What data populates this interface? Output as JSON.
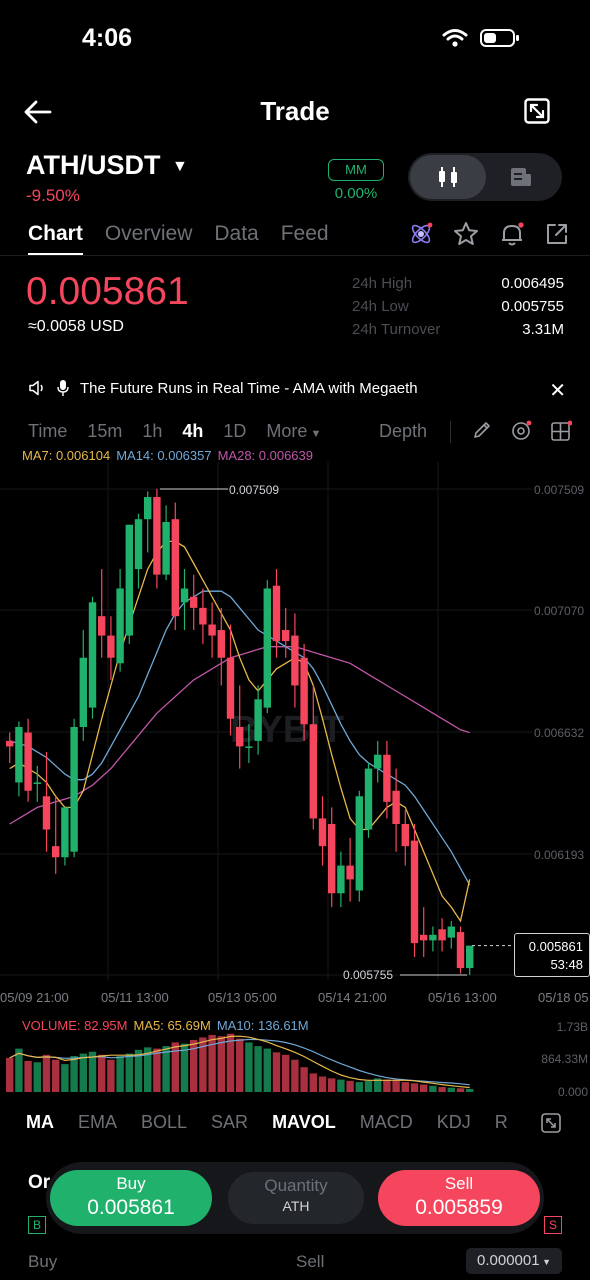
{
  "status": {
    "time": "4:06"
  },
  "header": {
    "title": "Trade"
  },
  "pair": {
    "name": "ATH/USDT",
    "change": "-9.50%",
    "mm_label": "MM",
    "mm_value": "0.00%"
  },
  "tabs": [
    {
      "label": "Chart",
      "active": true
    },
    {
      "label": "Overview",
      "active": false
    },
    {
      "label": "Data",
      "active": false
    },
    {
      "label": "Feed",
      "active": false
    }
  ],
  "price": {
    "last": "0.005861",
    "usd": "≈0.0058 USD",
    "stats": [
      {
        "label": "24h High",
        "value": "0.006495"
      },
      {
        "label": "24h Low",
        "value": "0.005755"
      },
      {
        "label": "24h Turnover",
        "value": "3.31M"
      }
    ]
  },
  "banner": {
    "text": "The Future Runs in Real Time -  AMA with Megaeth"
  },
  "intervals": [
    {
      "label": "Time",
      "active": false
    },
    {
      "label": "15m",
      "active": false
    },
    {
      "label": "1h",
      "active": false
    },
    {
      "label": "4h",
      "active": true
    },
    {
      "label": "1D",
      "active": false
    },
    {
      "label": "More",
      "active": false
    }
  ],
  "depth_label": "Depth",
  "ma_readout": {
    "ma7": "MA7: 0.006104",
    "ma14": "MA14: 0.006357",
    "ma28": "MA28: 0.006639"
  },
  "colors": {
    "up": "#20b26c",
    "down": "#f6465d",
    "ma7": "#e8b84a",
    "ma14": "#6fa8d6",
    "ma28": "#c056a8"
  },
  "chart": {
    "y_labels": [
      "0.007509",
      "0.007070",
      "0.006632",
      "0.006193",
      "0.005755"
    ],
    "x_labels": [
      "05/09 21:00",
      "05/11 13:00",
      "05/13 05:00",
      "05/14 21:00",
      "05/16 13:00",
      "05/18 05"
    ],
    "high_marker": "0.007509",
    "low_marker": "0.005755",
    "price_tag": "0.005861",
    "countdown": "53:48",
    "watermark": "BYBIT"
  },
  "chart_data": {
    "type": "candlestick",
    "ylim": [
      0.005755,
      0.007509
    ],
    "candles": [
      {
        "o": 0.0066,
        "h": 0.00663,
        "c": 0.00658,
        "l": 0.00652
      },
      {
        "o": 0.00645,
        "h": 0.00667,
        "c": 0.00665,
        "l": 0.0064
      },
      {
        "o": 0.00663,
        "h": 0.00668,
        "c": 0.00642,
        "l": 0.00638
      },
      {
        "o": 0.00645,
        "h": 0.00651,
        "c": 0.00645,
        "l": 0.00638
      },
      {
        "o": 0.0064,
        "h": 0.00656,
        "c": 0.00628,
        "l": 0.0062
      },
      {
        "o": 0.00622,
        "h": 0.0064,
        "c": 0.00618,
        "l": 0.00612
      },
      {
        "o": 0.00618,
        "h": 0.00636,
        "c": 0.00636,
        "l": 0.00615
      },
      {
        "o": 0.0062,
        "h": 0.00668,
        "c": 0.00665,
        "l": 0.00618
      },
      {
        "o": 0.00665,
        "h": 0.007,
        "c": 0.0069,
        "l": 0.0066
      },
      {
        "o": 0.00672,
        "h": 0.00712,
        "c": 0.0071,
        "l": 0.00668
      },
      {
        "o": 0.00705,
        "h": 0.00722,
        "c": 0.00698,
        "l": 0.0069
      },
      {
        "o": 0.00698,
        "h": 0.00705,
        "c": 0.0069,
        "l": 0.00682
      },
      {
        "o": 0.00688,
        "h": 0.00722,
        "c": 0.00715,
        "l": 0.00685
      },
      {
        "o": 0.00698,
        "h": 0.00738,
        "c": 0.00738,
        "l": 0.00695
      },
      {
        "o": 0.00722,
        "h": 0.00742,
        "c": 0.0074,
        "l": 0.00715
      },
      {
        "o": 0.0074,
        "h": 0.0075,
        "c": 0.00748,
        "l": 0.00728
      },
      {
        "o": 0.00748,
        "h": 0.00751,
        "c": 0.0072,
        "l": 0.00715
      },
      {
        "o": 0.0072,
        "h": 0.00745,
        "c": 0.00739,
        "l": 0.00718
      },
      {
        "o": 0.0074,
        "h": 0.00746,
        "c": 0.00705,
        "l": 0.007
      },
      {
        "o": 0.0071,
        "h": 0.00722,
        "c": 0.00715,
        "l": 0.007
      },
      {
        "o": 0.00712,
        "h": 0.0072,
        "c": 0.00708,
        "l": 0.007
      },
      {
        "o": 0.00708,
        "h": 0.00715,
        "c": 0.00702,
        "l": 0.00695
      },
      {
        "o": 0.00702,
        "h": 0.0071,
        "c": 0.00698,
        "l": 0.0069
      },
      {
        "o": 0.007,
        "h": 0.00708,
        "c": 0.0069,
        "l": 0.0068
      },
      {
        "o": 0.0069,
        "h": 0.00702,
        "c": 0.00668,
        "l": 0.00662
      },
      {
        "o": 0.00665,
        "h": 0.0068,
        "c": 0.00658,
        "l": 0.0065
      },
      {
        "o": 0.00658,
        "h": 0.00666,
        "c": 0.00658,
        "l": 0.00652
      },
      {
        "o": 0.0066,
        "h": 0.0068,
        "c": 0.00675,
        "l": 0.00655
      },
      {
        "o": 0.00672,
        "h": 0.00718,
        "c": 0.00715,
        "l": 0.0067
      },
      {
        "o": 0.00716,
        "h": 0.00722,
        "c": 0.00696,
        "l": 0.0069
      },
      {
        "o": 0.007,
        "h": 0.00708,
        "c": 0.00696,
        "l": 0.0069
      },
      {
        "o": 0.00698,
        "h": 0.00706,
        "c": 0.0068,
        "l": 0.00672
      },
      {
        "o": 0.0069,
        "h": 0.00695,
        "c": 0.00666,
        "l": 0.0066
      },
      {
        "o": 0.00666,
        "h": 0.0068,
        "c": 0.00632,
        "l": 0.00628
      },
      {
        "o": 0.00632,
        "h": 0.0064,
        "c": 0.00622,
        "l": 0.00615
      },
      {
        "o": 0.0063,
        "h": 0.00636,
        "c": 0.00605,
        "l": 0.006
      },
      {
        "o": 0.00605,
        "h": 0.0062,
        "c": 0.00615,
        "l": 0.006
      },
      {
        "o": 0.00615,
        "h": 0.00625,
        "c": 0.0061,
        "l": 0.00602
      },
      {
        "o": 0.00606,
        "h": 0.00642,
        "c": 0.0064,
        "l": 0.00602
      },
      {
        "o": 0.00628,
        "h": 0.00652,
        "c": 0.0065,
        "l": 0.00625
      },
      {
        "o": 0.0065,
        "h": 0.0066,
        "c": 0.00655,
        "l": 0.00645
      },
      {
        "o": 0.00655,
        "h": 0.0066,
        "c": 0.00638,
        "l": 0.00632
      },
      {
        "o": 0.00642,
        "h": 0.0065,
        "c": 0.0063,
        "l": 0.0062
      },
      {
        "o": 0.0063,
        "h": 0.00635,
        "c": 0.00622,
        "l": 0.00615
      },
      {
        "o": 0.00624,
        "h": 0.0063,
        "c": 0.00587,
        "l": 0.00582
      },
      {
        "o": 0.0059,
        "h": 0.006,
        "c": 0.00588,
        "l": 0.00582
      },
      {
        "o": 0.00588,
        "h": 0.00593,
        "c": 0.0059,
        "l": 0.00584
      },
      {
        "o": 0.00592,
        "h": 0.00596,
        "c": 0.00588,
        "l": 0.00584
      },
      {
        "o": 0.00589,
        "h": 0.00595,
        "c": 0.00593,
        "l": 0.00585
      },
      {
        "o": 0.00591,
        "h": 0.00593,
        "c": 0.00578,
        "l": 0.00576
      },
      {
        "o": 0.00578,
        "h": 0.00582,
        "c": 0.005861,
        "l": 0.005755
      }
    ],
    "ma7": [
      0.0065,
      0.00652,
      0.0065,
      0.00648,
      0.00645,
      0.0064,
      0.00636,
      0.00636,
      0.00642,
      0.00655,
      0.00668,
      0.0068,
      0.00692,
      0.00702,
      0.00712,
      0.00722,
      0.00728,
      0.00732,
      0.00732,
      0.0073,
      0.00724,
      0.00718,
      0.00712,
      0.00706,
      0.007,
      0.0069,
      0.00682,
      0.00678,
      0.00682,
      0.00686,
      0.00688,
      0.0069,
      0.00688,
      0.0068,
      0.00668,
      0.00655,
      0.00643,
      0.00632,
      0.00628,
      0.00628,
      0.00632,
      0.00636,
      0.00638,
      0.00636,
      0.00628,
      0.0062,
      0.00612,
      0.00604,
      0.006,
      0.00595,
      0.0061
    ],
    "ma14": [
      0.0066,
      0.00659,
      0.00658,
      0.00656,
      0.00654,
      0.00651,
      0.00648,
      0.00646,
      0.00646,
      0.00648,
      0.00652,
      0.00658,
      0.00664,
      0.0067,
      0.00676,
      0.00684,
      0.00692,
      0.007,
      0.00706,
      0.0071,
      0.00712,
      0.00714,
      0.00714,
      0.00714,
      0.00712,
      0.00708,
      0.00704,
      0.007,
      0.00698,
      0.00696,
      0.00694,
      0.00692,
      0.0069,
      0.00686,
      0.0068,
      0.00673,
      0.00666,
      0.0066,
      0.00655,
      0.00652,
      0.0065,
      0.00648,
      0.00646,
      0.00644,
      0.0064,
      0.00635,
      0.0063,
      0.00625,
      0.0062,
      0.00614,
      0.00608
    ],
    "ma28": [
      0.0063,
      0.00632,
      0.00634,
      0.00636,
      0.00637,
      0.00638,
      0.00639,
      0.0064,
      0.00642,
      0.00644,
      0.00647,
      0.0065,
      0.00654,
      0.00658,
      0.00662,
      0.00666,
      0.0067,
      0.00673,
      0.00676,
      0.00679,
      0.00682,
      0.00684,
      0.00686,
      0.00688,
      0.0069,
      0.00691,
      0.00692,
      0.00693,
      0.00694,
      0.00694,
      0.00694,
      0.00694,
      0.00693,
      0.00692,
      0.00691,
      0.0069,
      0.00689,
      0.00688,
      0.00686,
      0.00684,
      0.00682,
      0.0068,
      0.00678,
      0.00676,
      0.00674,
      0.00672,
      0.0067,
      0.00668,
      0.00666,
      0.00664,
      0.00663
    ],
    "volume": [
      0.55,
      0.7,
      0.5,
      0.48,
      0.6,
      0.52,
      0.45,
      0.58,
      0.62,
      0.65,
      0.6,
      0.52,
      0.58,
      0.62,
      0.68,
      0.72,
      0.7,
      0.74,
      0.8,
      0.78,
      0.84,
      0.88,
      0.92,
      0.9,
      0.94,
      0.86,
      0.8,
      0.74,
      0.7,
      0.64,
      0.6,
      0.52,
      0.4,
      0.3,
      0.25,
      0.22,
      0.2,
      0.18,
      0.16,
      0.18,
      0.22,
      0.2,
      0.18,
      0.16,
      0.14,
      0.12,
      0.1,
      0.08,
      0.07,
      0.06,
      0.05
    ],
    "volume_ylim_labels": [
      "1.73B",
      "864.33M",
      "0.000"
    ]
  },
  "volume_readout": {
    "volume": "VOLUME: 82.95M",
    "ma5": "MA5: 65.69M",
    "ma10": "MA10: 136.61M"
  },
  "indicators": [
    {
      "label": "MA",
      "on": true
    },
    {
      "label": "EMA",
      "on": false
    },
    {
      "label": "BOLL",
      "on": false
    },
    {
      "label": "SAR",
      "on": false
    },
    {
      "label": "MAVOL",
      "on": true
    },
    {
      "label": "MACD",
      "on": false
    },
    {
      "label": "KDJ",
      "on": false
    },
    {
      "label": "R",
      "on": false
    }
  ],
  "trade": {
    "buy_label": "Buy",
    "buy_price": "0.005861",
    "qty_label": "Quantity",
    "qty_unit": "ATH",
    "sell_label": "Sell",
    "sell_price": "0.005859"
  },
  "orderbook": {
    "buy": "Buy",
    "sell": "Sell",
    "precision": "0.000001"
  }
}
